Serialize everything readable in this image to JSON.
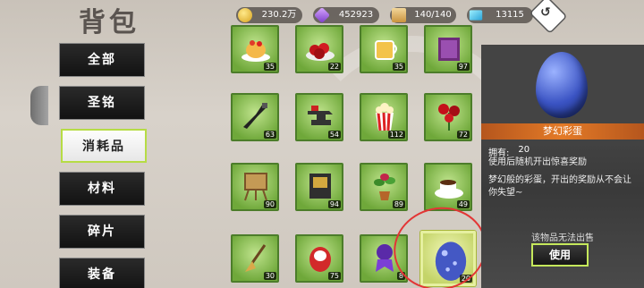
{
  "title": "背包",
  "resources": [
    {
      "icon": "gold-coin-icon",
      "value": "230.2万"
    },
    {
      "icon": "purple-gem-icon",
      "value": "452923"
    },
    {
      "icon": "box-icon",
      "value": "140/140"
    },
    {
      "icon": "diamond-icon",
      "value": "13115"
    }
  ],
  "back_icon": "↺",
  "tabs": [
    {
      "label": "全部"
    },
    {
      "label": "圣铭"
    },
    {
      "label": "消耗品",
      "active": true
    },
    {
      "label": "材料"
    },
    {
      "label": "碎片"
    },
    {
      "label": "装备"
    }
  ],
  "items": [
    {
      "name": "pudding-icon",
      "count": "35"
    },
    {
      "name": "cherries-icon",
      "count": "22"
    },
    {
      "name": "tea-icon",
      "count": "35"
    },
    {
      "name": "book-icon",
      "count": "97"
    },
    {
      "name": "guitar-icon",
      "count": "63"
    },
    {
      "name": "anvil-icon",
      "count": "54"
    },
    {
      "name": "popcorn-icon",
      "count": "112"
    },
    {
      "name": "roses-icon",
      "count": "72"
    },
    {
      "name": "easel-icon",
      "count": "90"
    },
    {
      "name": "notebook-icon",
      "count": "94"
    },
    {
      "name": "plant-icon",
      "count": "89"
    },
    {
      "name": "coffee-icon",
      "count": "49"
    },
    {
      "name": "broom-icon",
      "count": "30"
    },
    {
      "name": "daruma-icon",
      "count": "75"
    },
    {
      "name": "purple-doll-icon",
      "count": "8"
    },
    {
      "name": "dream-egg-icon",
      "count": "20",
      "selected": true
    }
  ],
  "detail": {
    "name": "梦幻彩蛋",
    "own_label": "拥有:",
    "own_value": "20",
    "desc1": "使用后随机开出惊喜奖励",
    "desc2": "梦幻般的彩蛋，开出的奖励从不会让你失望~",
    "nosell": "该物品无法出售",
    "use_label": "使用"
  }
}
